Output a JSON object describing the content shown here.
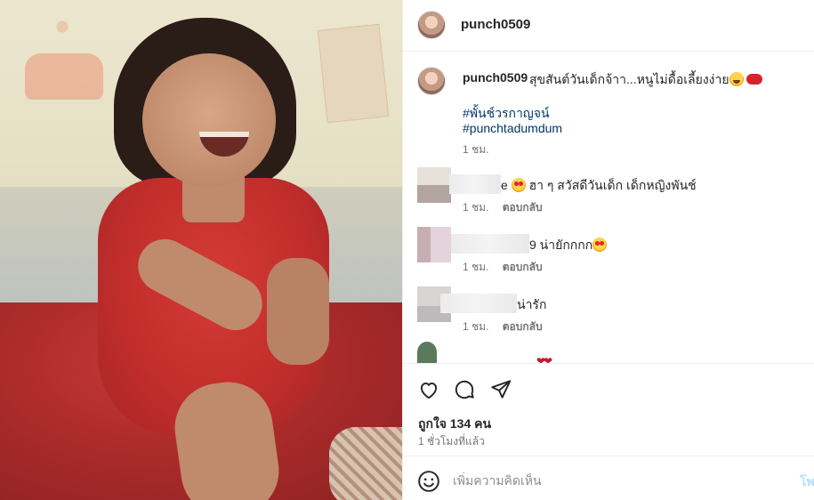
{
  "post": {
    "username": "punch0509",
    "photo_alt": "vintage photo of a smiling child in a red dress"
  },
  "caption": {
    "username": "punch0509",
    "text": "สุขสันต์วันเด็กจ้าา...หนูไม่ดื้อเลี้ยงง่าย",
    "hashtag_1": "#พั้นช์วรกาญจน์",
    "hashtag_2": "#punchtadumdum",
    "time": "1 ชม."
  },
  "comments": [
    {
      "username_tail": "e",
      "text": " ฮา ๆ สวัสดีวันเด็ก เด็กหญิงพันช์",
      "time": "1 ชม.",
      "reply": "ตอบกลับ",
      "emoji": "heart-eyes"
    },
    {
      "username_tail": "9",
      "text": " น่ายักกกก",
      "time": "1 ชม.",
      "reply": "ตอบกลับ",
      "emoji": "heart-eyes"
    },
    {
      "username_tail": "",
      "text": " น่ารัก",
      "time": "1 ชม.",
      "reply": "ตอบกลับ",
      "emoji": ""
    }
  ],
  "actions": {
    "icons": [
      "heart-icon",
      "comment-icon",
      "share-icon"
    ],
    "likes": "ถูกใจ 134 คน",
    "posted": "1 ชั่วโมงที่แล้ว"
  },
  "composer": {
    "placeholder": "เพิ่มความคิดเห็น",
    "post_label": "โพสต์"
  },
  "colors": {
    "link": "#00376b",
    "muted": "#737373",
    "post_button": "#b2dffc",
    "border": "#efefef"
  }
}
